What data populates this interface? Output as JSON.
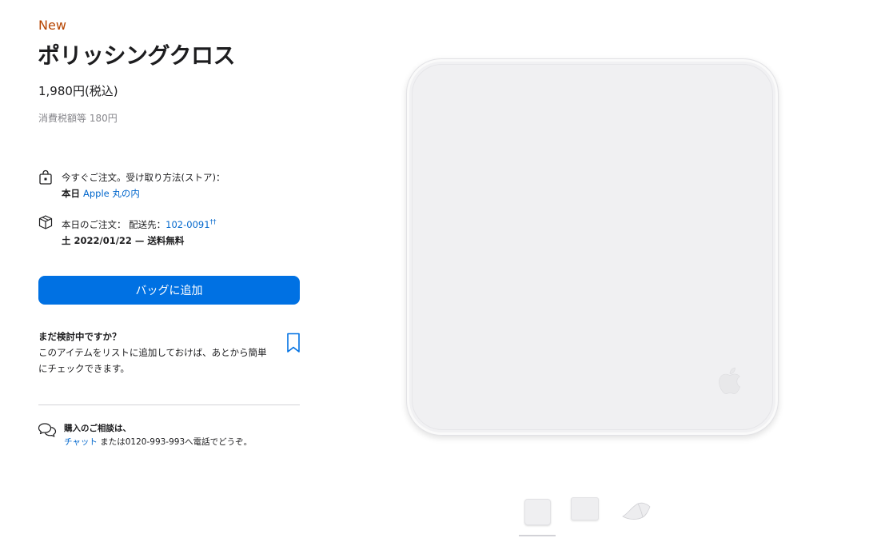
{
  "product": {
    "badge": "New",
    "name": "ポリッシングクロス",
    "price": "1,980円(税込)",
    "tax_note": "消費税額等 180円"
  },
  "pickup": {
    "line1": "今すぐご注文。受け取り方法(ストア)：",
    "when": "本日",
    "store": "Apple 丸の内"
  },
  "delivery": {
    "line1_prefix": "本日のご注文：  配送先：",
    "postal_code": "102-0091",
    "postal_mark": "††",
    "date_line": "土 2022/01/22 — 送料無料"
  },
  "add_to_bag_label": "バッグに追加",
  "save_for_later": {
    "heading": "まだ検討中ですか？",
    "body_line1": "このアイテムをリストに追加しておけば、あとから簡単",
    "body_line2": "にチェックできます。"
  },
  "help": {
    "heading": "購入のご相談は、",
    "chat_link": "チャット",
    "rest": "または0120-993-993へ電話でどうぞ。"
  },
  "gallery": {
    "thumbnails": [
      "polishing-cloth-front",
      "polishing-cloth-flat",
      "polishing-cloth-folded"
    ],
    "selected_index": 0
  },
  "colors": {
    "badge": "#b64400",
    "button": "#0071e3",
    "link": "#0066cc"
  }
}
